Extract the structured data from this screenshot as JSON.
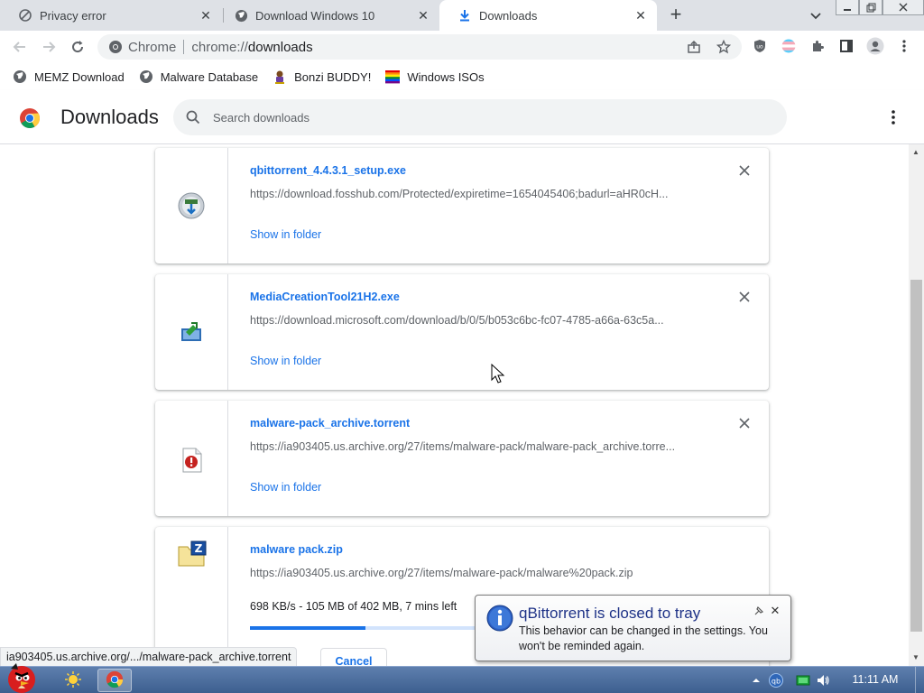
{
  "browser": {
    "tabs": [
      {
        "title": "Privacy error",
        "icon": "warning-icon",
        "active": false
      },
      {
        "title": "Download Windows 10",
        "icon": "globe-icon",
        "active": false
      },
      {
        "title": "Downloads",
        "icon": "download-icon",
        "active": true
      }
    ],
    "close_glyph": "✕",
    "new_tab_glyph": "+",
    "omnibox": {
      "chip": "Chrome",
      "url_scheme": "chrome://",
      "url_path": "downloads"
    }
  },
  "bookmarks": [
    {
      "label": "MEMZ Download",
      "icon": "globe-icon"
    },
    {
      "label": "Malware Database",
      "icon": "globe-icon"
    },
    {
      "label": "Bonzi BUDDY!",
      "icon": "bonzi-icon"
    },
    {
      "label": "Windows ISOs",
      "icon": "windows-flag-icon"
    }
  ],
  "downloads_page": {
    "title": "Downloads",
    "search_placeholder": "Search downloads"
  },
  "downloads": [
    {
      "filename": "qbittorrent_4.4.3.1_setup.exe",
      "url": "https://download.fosshub.com/Protected/expiretime=1654045406;badurl=aHR0cH...",
      "action": "Show in folder",
      "icon": "qbittorrent-installer-icon"
    },
    {
      "filename": "MediaCreationTool21H2.exe",
      "url": "https://download.microsoft.com/download/b/0/5/b053c6bc-fc07-4785-a66a-63c5a...",
      "action": "Show in folder",
      "icon": "media-creation-tool-icon"
    },
    {
      "filename": "malware-pack_archive.torrent",
      "url": "https://ia903405.us.archive.org/27/items/malware-pack/malware-pack_archive.torre...",
      "action": "Show in folder",
      "icon": "torrent-file-icon"
    },
    {
      "filename": "malware pack.zip",
      "url": "https://ia903405.us.archive.org/27/items/malware-pack/malware%20pack.zip",
      "status": "698 KB/s - 105 MB of 402 MB, 7 mins left",
      "progress": 0.27,
      "cancel": "Cancel",
      "icon": "zip-folder-icon"
    }
  ],
  "status_bubble": "ia903405.us.archive.org/.../malware-pack_archive.torrent",
  "notification": {
    "title": "qBittorrent is closed to tray",
    "body": "This behavior can be changed in the settings. You won't be reminded again."
  },
  "taskbar": {
    "clock": "11:11 AM"
  },
  "colors": {
    "accent": "#1a73e8",
    "taskbar": "#4a6c9e"
  }
}
